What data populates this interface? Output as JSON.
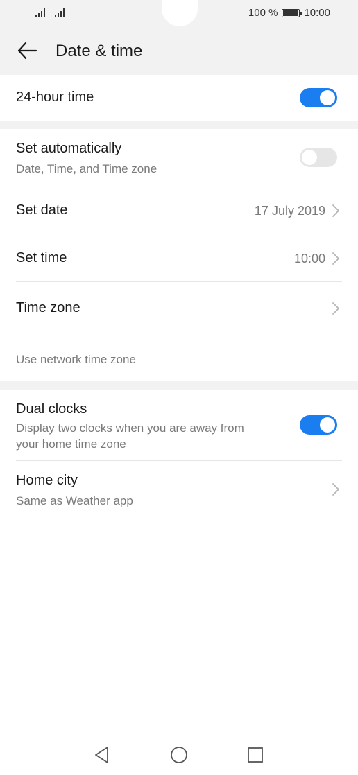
{
  "status_bar": {
    "battery_percent": "100 %",
    "time": "10:00"
  },
  "header": {
    "title": "Date & time",
    "back_icon": "arrow-left-icon"
  },
  "settings": {
    "hour24": {
      "label": "24-hour time",
      "enabled": true
    },
    "set_automatically": {
      "label": "Set automatically",
      "description": "Date, Time, and Time zone",
      "enabled": false
    },
    "set_date": {
      "label": "Set date",
      "value": "17 July 2019"
    },
    "set_time": {
      "label": "Set time",
      "value": "10:00"
    },
    "time_zone": {
      "label": "Time zone",
      "note": "Use network time zone"
    },
    "dual_clocks": {
      "label": "Dual clocks",
      "description_line1": "Display two clocks when you are away from",
      "description_line2": "your home time zone",
      "enabled": true
    },
    "home_city": {
      "label": "Home city",
      "description": "Same as Weather app"
    }
  },
  "nav_bar": {
    "back": "triangle-back-icon",
    "home": "circle-home-icon",
    "recents": "square-recents-icon"
  },
  "colors": {
    "accent": "#1a7df0",
    "header_bg": "#f2f2f2",
    "secondary_text": "#7a7a7a"
  }
}
